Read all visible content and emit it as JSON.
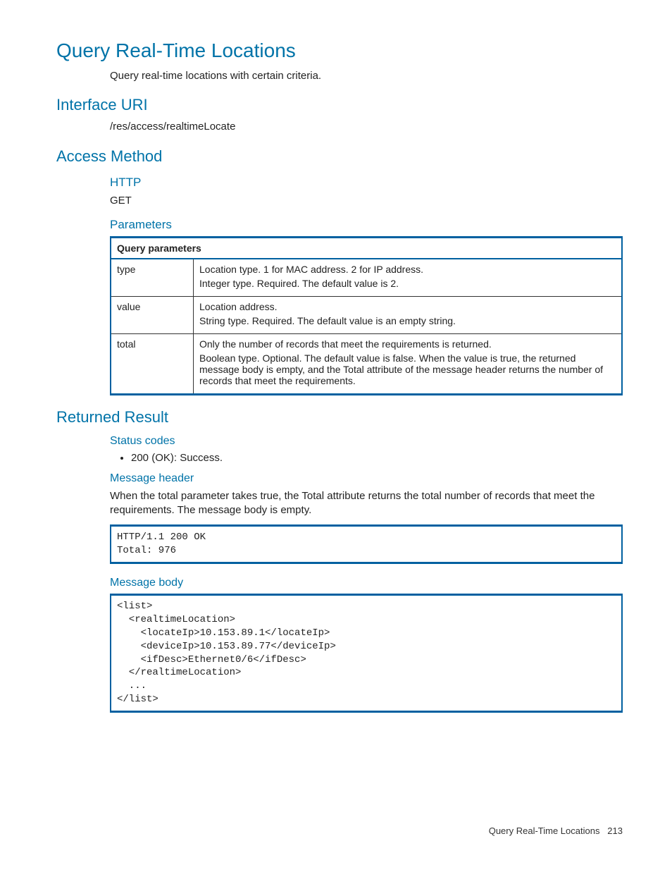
{
  "title": "Query Real-Time Locations",
  "intro": "Query real-time locations with certain criteria.",
  "interface_uri": {
    "heading": "Interface URI",
    "uri": "/res/access/realtimeLocate"
  },
  "access_method": {
    "heading": "Access Method",
    "http_label": "HTTP",
    "http_method": "GET",
    "parameters_label": "Parameters",
    "table_caption": "Query parameters",
    "params": [
      {
        "name": "type",
        "desc1": "Location type. 1 for MAC address. 2 for IP address.",
        "desc2": "Integer type. Required. The default value is 2."
      },
      {
        "name": "value",
        "desc1": "Location address.",
        "desc2": "String type. Required. The default value is an empty string."
      },
      {
        "name": "total",
        "desc1": "Only the number of records that meet the requirements is returned.",
        "desc2": "Boolean type. Optional. The default value is false. When the value is true, the returned message body is empty, and the Total attribute of the message header returns the number of records that meet the requirements."
      }
    ]
  },
  "returned_result": {
    "heading": "Returned Result",
    "status_codes_label": "Status codes",
    "status_codes": [
      "200 (OK): Success."
    ],
    "message_header_label": "Message header",
    "message_header_text": "When the total parameter takes true, the Total attribute returns the total number of records that meet the requirements. The message body is empty.",
    "message_header_code": "HTTP/1.1 200 OK\nTotal: 976",
    "message_body_label": "Message body",
    "message_body_code": "<list>\n  <realtimeLocation>\n    <locateIp>10.153.89.1</locateIp>\n    <deviceIp>10.153.89.77</deviceIp>\n    <ifDesc>Ethernet0/6</ifDesc>\n  </realtimeLocation>\n  ...\n</list>"
  },
  "footer": {
    "text": "Query Real-Time Locations",
    "page": "213"
  }
}
